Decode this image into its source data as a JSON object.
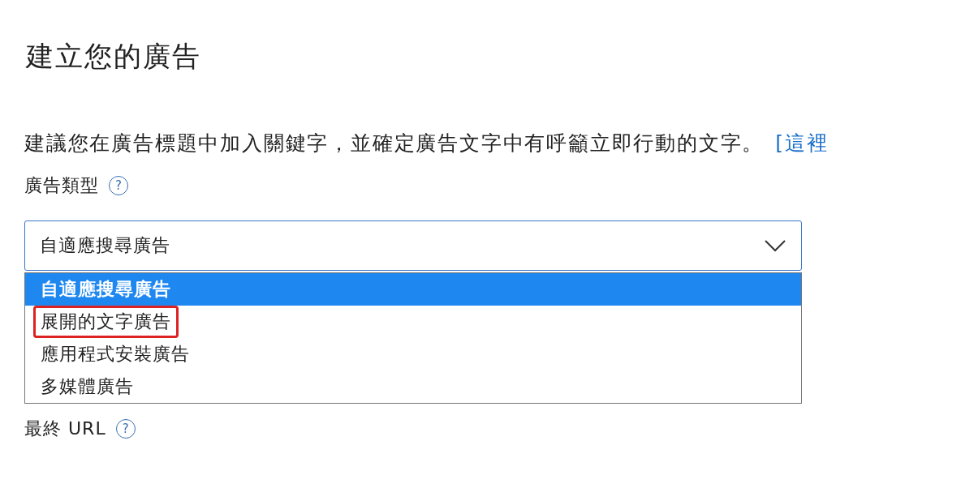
{
  "title": "建立您的廣告",
  "hint": {
    "text": "建議您在廣告標題中加入關鍵字，並確定廣告文字中有呼籲立即行動的文字。",
    "link": "[這裡"
  },
  "ad_type": {
    "label": "廣告類型",
    "help": "?",
    "value": "自適應搜尋廣告",
    "options": [
      {
        "label": "自適應搜尋廣告",
        "selected": true,
        "highlighted": false
      },
      {
        "label": "展開的文字廣告",
        "selected": false,
        "highlighted": true
      },
      {
        "label": "應用程式安裝廣告",
        "selected": false,
        "highlighted": false
      },
      {
        "label": "多媒體廣告",
        "selected": false,
        "highlighted": false
      }
    ]
  },
  "final_url": {
    "label": "最終 URL",
    "help": "?"
  }
}
